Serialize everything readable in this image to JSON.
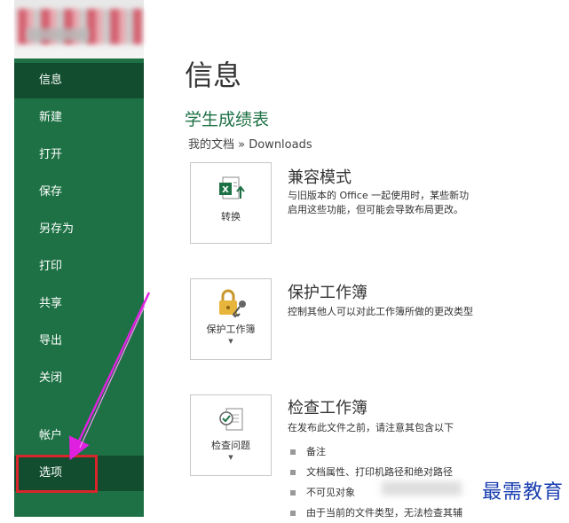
{
  "sidebar": {
    "items": [
      {
        "label": "信息",
        "active": true
      },
      {
        "label": "新建"
      },
      {
        "label": "打开"
      },
      {
        "label": "保存"
      },
      {
        "label": "另存为"
      },
      {
        "label": "打印"
      },
      {
        "label": "共享"
      },
      {
        "label": "导出"
      },
      {
        "label": "关闭"
      }
    ],
    "account": "帐户",
    "options": "选项"
  },
  "main": {
    "title": "信息",
    "doc_title": "学生成绩表",
    "doc_path": "我的文档 » Downloads",
    "sections": [
      {
        "tile_label": "转换",
        "tile_icon": "excel-convert-icon",
        "title": "兼容模式",
        "desc": [
          "与旧版本的 Office 一起使用时，某些新功",
          "启用这些功能，但可能会导致布局更改。"
        ]
      },
      {
        "tile_label": "保护工作簿",
        "tile_icon": "lock-key-icon",
        "title": "保护工作簿",
        "desc": [
          "控制其他人可以对此工作簿所做的更改类型"
        ]
      },
      {
        "tile_label": "检查问题",
        "tile_icon": "document-check-icon",
        "title": "检查工作簿",
        "desc": [
          "在发布此文件之前，请注意其包含以下"
        ],
        "bullets": [
          "备注",
          "文档属性、打印机路径和绝对路径",
          "不可见对象",
          "由于当前的文件类型，无法检查其辅"
        ]
      }
    ]
  },
  "watermark": "最需教育",
  "colors": {
    "sidebar": "#1e7145",
    "sidebar_active": "#114d2e",
    "accent": "#1e7145",
    "annotation": "#e020e0",
    "highlight": "#d9262c"
  }
}
